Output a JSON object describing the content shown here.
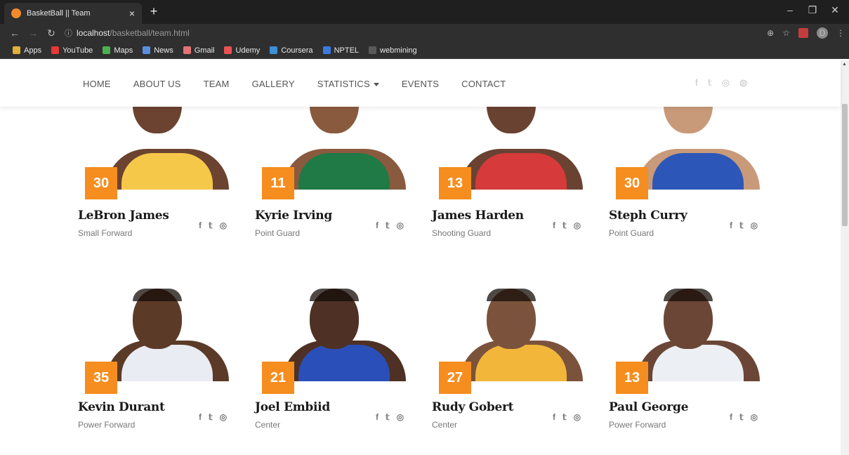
{
  "browser": {
    "tab_title": "BasketBall || Team",
    "tab_close": "×",
    "new_tab": "+",
    "url_info": "ⓘ",
    "url_host": "localhost",
    "url_path": "/basketball/team.html",
    "profile_initial": "D",
    "window_controls": [
      "–",
      "❐",
      "✕"
    ],
    "bookmarks": [
      {
        "label": "Apps",
        "color": "#e0b03a"
      },
      {
        "label": "YouTube",
        "color": "#e53935"
      },
      {
        "label": "Maps",
        "color": "#4caf50"
      },
      {
        "label": "News",
        "color": "#5a8fe0"
      },
      {
        "label": "Gmail",
        "color": "#e57373"
      },
      {
        "label": "Udemy",
        "color": "#ec5252"
      },
      {
        "label": "Coursera",
        "color": "#3d8fd6"
      },
      {
        "label": "NPTEL",
        "color": "#3a7be0"
      },
      {
        "label": "webmining",
        "color": "#5a5a5a"
      }
    ]
  },
  "nav": {
    "items": [
      "HOME",
      "ABOUT US",
      "TEAM",
      "GALLERY",
      "STATISTICS",
      "EVENTS",
      "CONTACT"
    ],
    "social": [
      "f",
      "𝕥",
      "◎",
      "◍"
    ]
  },
  "colors": {
    "accent": "#f68d1f"
  },
  "players": [
    {
      "name": "LeBron James",
      "position": "Small Forward",
      "number": "30",
      "skin": "#6b4330",
      "jersey": "#f6c84a"
    },
    {
      "name": "Kyrie Irving",
      "position": "Point Guard",
      "number": "11",
      "skin": "#8a5a3e",
      "jersey": "#1f7a45"
    },
    {
      "name": "James Harden",
      "position": "Shooting Guard",
      "number": "13",
      "skin": "#6a4232",
      "jersey": "#d63a3a"
    },
    {
      "name": "Steph Curry",
      "position": "Point Guard",
      "number": "30",
      "skin": "#c89a7a",
      "jersey": "#2c57b8"
    },
    {
      "name": "Kevin Durant",
      "position": "Power Forward",
      "number": "35",
      "skin": "#5c3a28",
      "jersey": "#e9ecf2"
    },
    {
      "name": "Joel Embiid",
      "position": "Center",
      "number": "21",
      "skin": "#4e3124",
      "jersey": "#2b4fb8"
    },
    {
      "name": "Rudy Gobert",
      "position": "Center",
      "number": "27",
      "skin": "#7b533c",
      "jersey": "#f2b73a"
    },
    {
      "name": "Paul George",
      "position": "Power Forward",
      "number": "13",
      "skin": "#6b4636",
      "jersey": "#eceff3"
    }
  ],
  "card_social": [
    "f",
    "𝕥",
    "◎"
  ]
}
